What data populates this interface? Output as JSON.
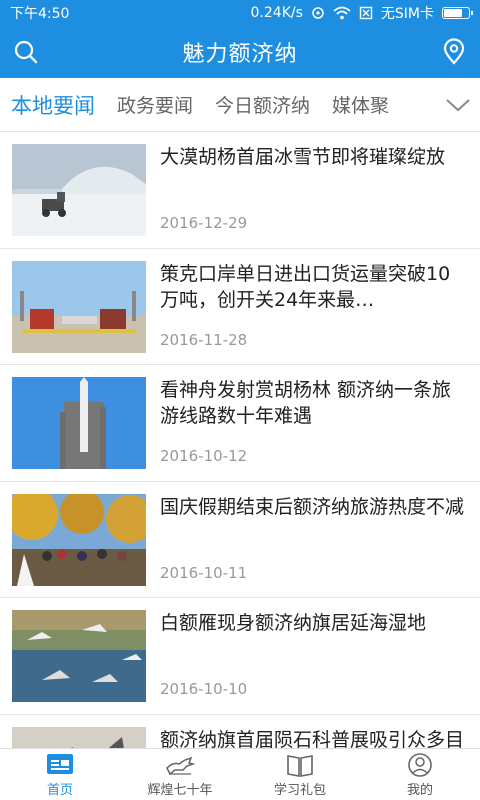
{
  "status": {
    "time": "下午4:50",
    "net_speed": "0.24K/s",
    "sim": "无SIM卡"
  },
  "app_bar": {
    "title": "魅力额济纳"
  },
  "tabs": [
    "本地要闻",
    "政务要闻",
    "今日额济纳",
    "媒体聚"
  ],
  "news": [
    {
      "title": "大漠胡杨首届冰雪节即将璀璨绽放",
      "date": "2016-12-29"
    },
    {
      "title": "策克口岸单日进出口货运量突破10万吨，创开关24年来最…",
      "date": "2016-11-28"
    },
    {
      "title": "看神舟发射赏胡杨林 额济纳一条旅游线路数十年难遇",
      "date": "2016-10-12"
    },
    {
      "title": "国庆假期结束后额济纳旅游热度不减",
      "date": "2016-10-11"
    },
    {
      "title": "白额雁现身额济纳旗居延海湿地",
      "date": "2016-10-10"
    },
    {
      "title": "额济纳旗首届陨石科普展吸引众多目光",
      "date": ""
    }
  ],
  "bottom_nav": [
    {
      "label": "首页"
    },
    {
      "label": "辉煌七十年"
    },
    {
      "label": "学习礼包"
    },
    {
      "label": "我的"
    }
  ],
  "colors": {
    "accent": "#1E8FE0"
  }
}
